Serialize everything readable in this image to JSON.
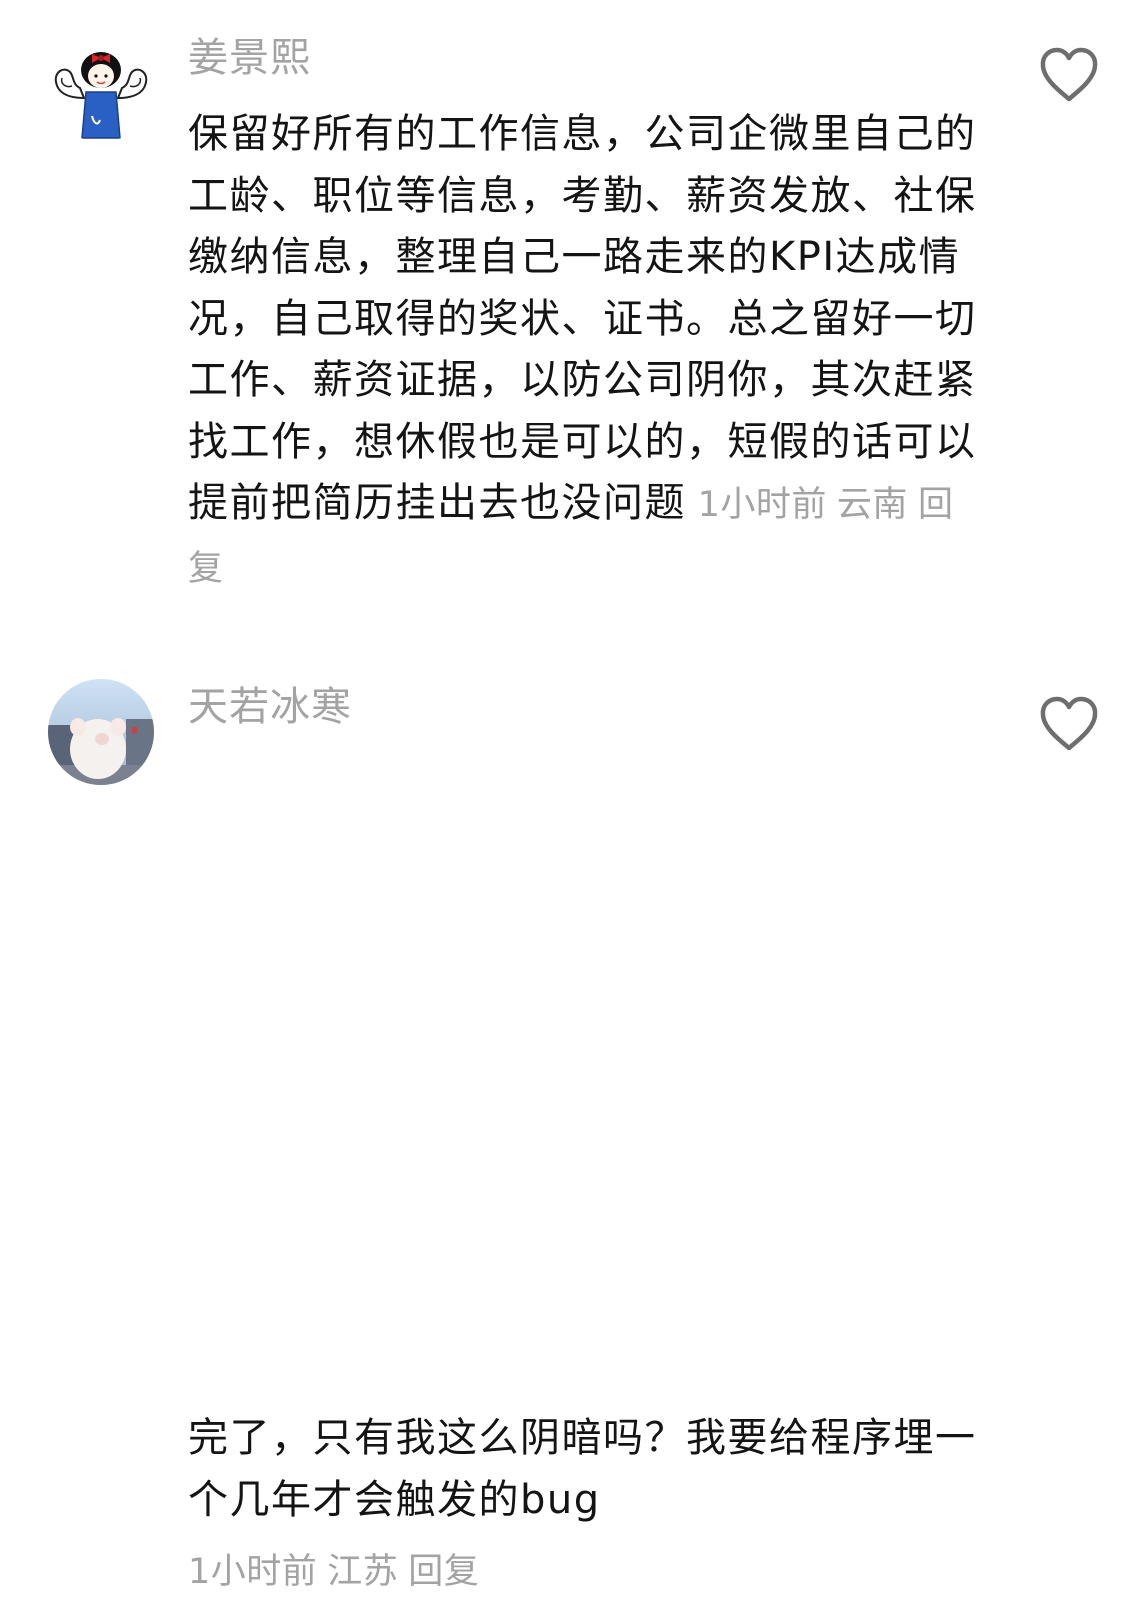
{
  "comments": [
    {
      "username": "姜景熙",
      "text": "保留好所有的工作信息，公司企微里自己的工龄、职位等信息，考勤、薪资发放、社保缴纳信息，整理自己一路走来的KPI达成情况，自己取得的奖状、证书。总之留好一切工作、薪资证据，以防公司阴你，其次赶紧找工作，想休假也是可以的，短假的话可以提前把简历挂出去也没问题",
      "time": "1小时前",
      "location": "云南",
      "reply_label": "回复",
      "avatar_icon": "cartoon-girl-flexing-icon",
      "like_icon": "heart-outline-icon"
    },
    {
      "username": "天若冰寒",
      "text": "完了，只有我这么阴暗吗？我要给程序埋一个几年才会触发的bug",
      "time": "1小时前",
      "location": "江苏",
      "reply_label": "回复",
      "avatar_icon": "white-cat-photo-icon",
      "like_icon": "heart-outline-icon"
    }
  ],
  "colors": {
    "username": "#a3a3a3",
    "body_text": "#141414",
    "meta": "#a3a3a3",
    "icon": "#6e6e6e",
    "background": "#ffffff"
  }
}
